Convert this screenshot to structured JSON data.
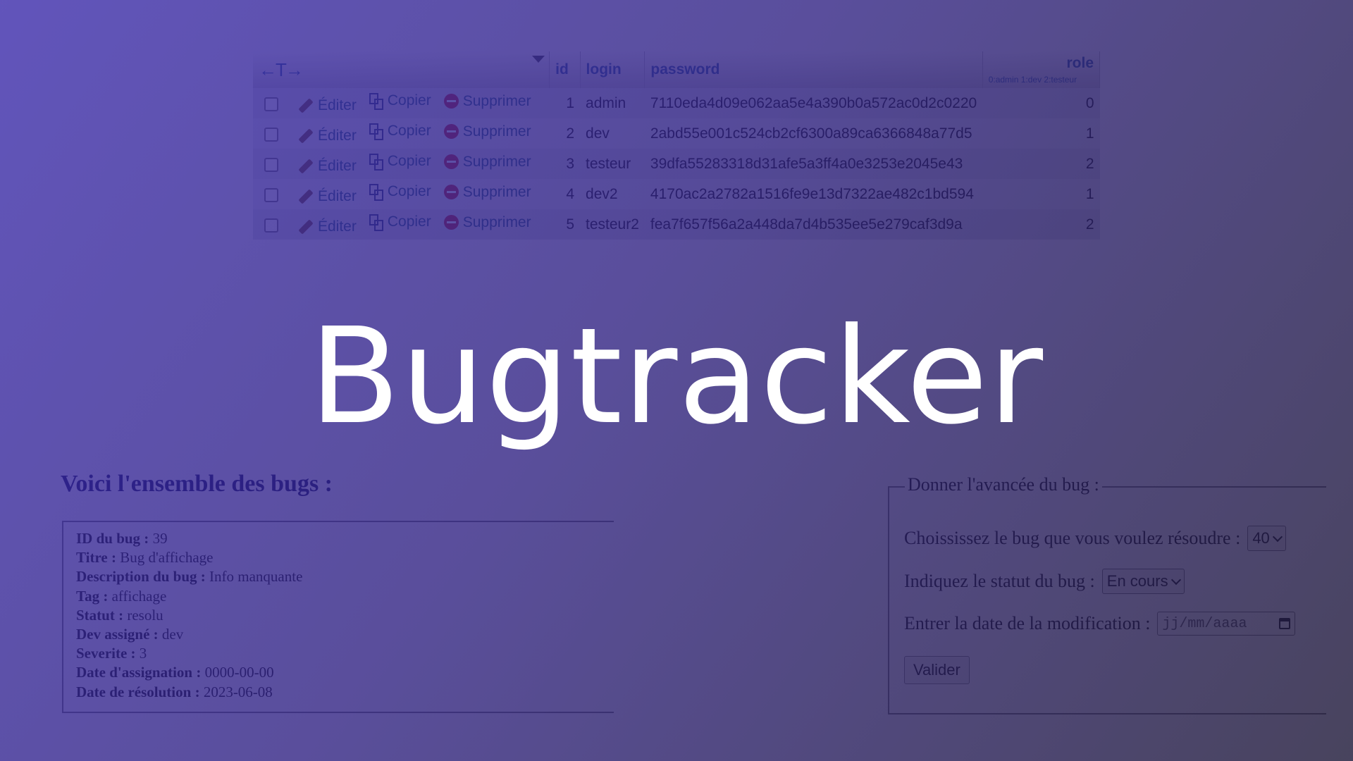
{
  "users_table": {
    "columns": {
      "nav_arrows": "←T→",
      "id": "id",
      "login": "login",
      "password": "password",
      "role": "role",
      "role_legend": "0:admin 1:dev 2:testeur"
    },
    "actions": {
      "edit": "Éditer",
      "copy": "Copier",
      "delete": "Supprimer"
    },
    "rows": [
      {
        "id": "1",
        "login": "admin",
        "password": "7110eda4d09e062aa5e4a390b0a572ac0d2c0220",
        "role": "0"
      },
      {
        "id": "2",
        "login": "dev",
        "password": "2abd55e001c524cb2cf6300a89ca6366848a77d5",
        "role": "1"
      },
      {
        "id": "3",
        "login": "testeur",
        "password": "39dfa55283318d31afe5a3ff4a0e3253e2045e43",
        "role": "2"
      },
      {
        "id": "4",
        "login": "dev2",
        "password": "4170ac2a2782a1516fe9e13d7322ae482c1bd594",
        "role": "1"
      },
      {
        "id": "5",
        "login": "testeur2",
        "password": "fea7f657f56a2a448da7d4b535ee5e279caf3d9a",
        "role": "2"
      }
    ]
  },
  "hero": {
    "title": "Bugtracker"
  },
  "bug_list": {
    "heading": "Voici l'ensemble des bugs :",
    "fields": [
      {
        "label": "ID du bug :",
        "value": "39"
      },
      {
        "label": "Titre :",
        "value": "Bug d'affichage"
      },
      {
        "label": "Description du bug :",
        "value": "Info manquante"
      },
      {
        "label": "Tag :",
        "value": "affichage"
      },
      {
        "label": "Statut :",
        "value": "resolu"
      },
      {
        "label": "Dev assigné :",
        "value": "dev"
      },
      {
        "label": "Severite :",
        "value": "3"
      },
      {
        "label": "Date d'assignation :",
        "value": "0000-00-00"
      },
      {
        "label": "Date de résolution :",
        "value": "2023-06-08"
      }
    ]
  },
  "progress_form": {
    "legend": "Donner l'avancée du bug :",
    "bug_select_label": "Choississez le bug que vous voulez résoudre :",
    "bug_select_value": "40",
    "status_label": "Indiquez le statut du bug :",
    "status_value": "En cours",
    "date_label": "Entrer la date de la modification :",
    "date_placeholder": "jj/mm/aaaa",
    "submit_label": "Valider"
  },
  "colors": {
    "overlay_start": "#3a2aaa",
    "overlay_end": "#201a3a",
    "hero_text": "#ffffff",
    "link_blue": "#235a81"
  }
}
